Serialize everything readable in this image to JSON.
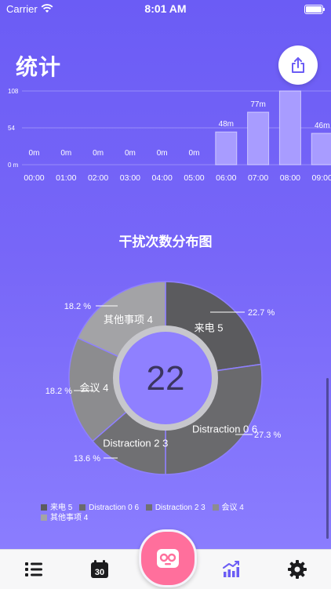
{
  "status_bar": {
    "carrier": "Carrier",
    "time": "8:01 AM"
  },
  "header": {
    "title": "统计"
  },
  "share_button": {
    "icon": "share-icon"
  },
  "colors": {
    "accent": "#6b5cf5",
    "center_button": "#ff6f9c",
    "active_tab": "#6b5cf5",
    "inactive_tab": "#1c1c1e",
    "bar_fill": "#a89cff",
    "pie": [
      "#5b5b5e",
      "#6a6a6d",
      "#707073",
      "#8c8c8f",
      "#a3a3a6"
    ]
  },
  "bar_chart_data": {
    "type": "bar",
    "y_ticks": [
      "108",
      "54",
      "0 m"
    ],
    "ylim": [
      0,
      108
    ],
    "categories": [
      "00:00",
      "01:00",
      "02:00",
      "03:00",
      "04:00",
      "05:00",
      "06:00",
      "07:00",
      "08:00",
      "09:00"
    ],
    "values": [
      0,
      0,
      0,
      0,
      0,
      0,
      48,
      77,
      108,
      46
    ],
    "labels": [
      "0m",
      "0m",
      "0m",
      "0m",
      "0m",
      "0m",
      "48m",
      "77m",
      "",
      "46m"
    ]
  },
  "chart_data": {
    "type": "pie",
    "title": "干扰次数分布图",
    "center_value": "22",
    "slices": [
      {
        "name": "来电",
        "value": 5,
        "percent_label": "22.7 %",
        "label": "来电 5"
      },
      {
        "name": "Distraction 0",
        "value": 6,
        "percent_label": "27.3 %",
        "label": "Distraction 0 6"
      },
      {
        "name": "Distraction 2",
        "value": 3,
        "percent_label": "13.6 %",
        "label": "Distraction 2 3"
      },
      {
        "name": "会议",
        "value": 4,
        "percent_label": "18.2 %",
        "label": "会议 4"
      },
      {
        "name": "其他事项",
        "value": 4,
        "percent_label": "18.2 %",
        "label": "其他事项 4"
      }
    ],
    "legend": [
      "来电 5",
      "Distraction 0 6",
      "Distraction 2 3",
      "会议 4",
      "其他事项 4"
    ]
  },
  "tab_bar": {
    "items": [
      {
        "icon": "list-icon",
        "active": false
      },
      {
        "icon": "calendar-icon",
        "label": "30",
        "active": false
      },
      {
        "icon": "robot-face-icon",
        "active": false
      },
      {
        "icon": "chart-trend-icon",
        "active": true
      },
      {
        "icon": "gear-icon",
        "active": false
      }
    ]
  }
}
